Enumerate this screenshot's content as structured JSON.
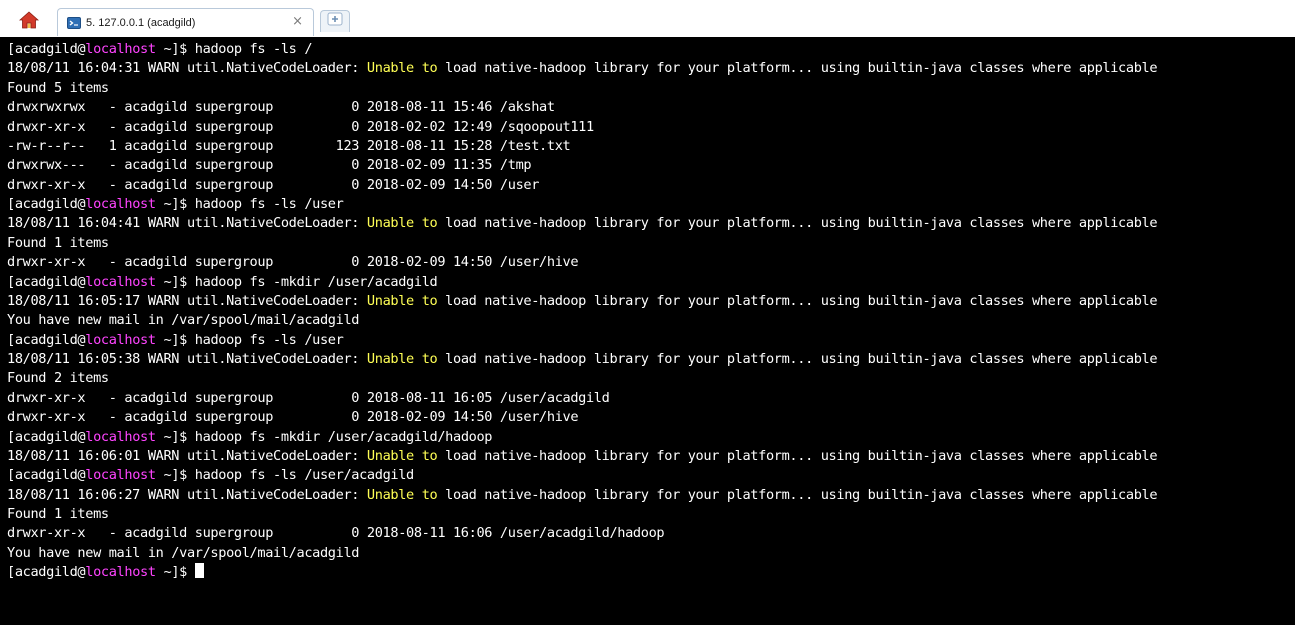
{
  "tab": {
    "title": "5. 127.0.0.1 (acadgild)",
    "close_glyph": "×"
  },
  "colors": {
    "terminal_bg": "#000000",
    "text": "#ffffff",
    "host": "#ff44ff",
    "highlight": "#ffff55",
    "tab_border": "#b9c9da"
  },
  "icons": {
    "home": "home-icon",
    "session": "terminal-session-icon",
    "close": "close-icon",
    "new_tab": "new-tab-icon"
  },
  "terminal": {
    "lines": [
      [
        {
          "t": "[acadgild@"
        },
        {
          "t": "localhost",
          "c": "host"
        },
        {
          "t": " ~]$ hadoop fs -ls /"
        }
      ],
      [
        {
          "t": "18/08/11 16:04:31 WARN util.NativeCodeLoader: "
        },
        {
          "t": "Unable to",
          "c": "warn"
        },
        {
          "t": " load native-hadoop library for your platform... using builtin-java classes where applicable"
        }
      ],
      [
        {
          "t": "Found 5 items"
        }
      ],
      [
        {
          "t": "drwxrwxrwx   - acadgild supergroup          0 2018-08-11 15:46 /akshat"
        }
      ],
      [
        {
          "t": "drwxr-xr-x   - acadgild supergroup          0 2018-02-02 12:49 /sqoopout111"
        }
      ],
      [
        {
          "t": "-rw-r--r--   1 acadgild supergroup        123 2018-08-11 15:28 /test.txt"
        }
      ],
      [
        {
          "t": "drwxrwx---   - acadgild supergroup          0 2018-02-09 11:35 /tmp"
        }
      ],
      [
        {
          "t": "drwxr-xr-x   - acadgild supergroup          0 2018-02-09 14:50 /user"
        }
      ],
      [
        {
          "t": "[acadgild@"
        },
        {
          "t": "localhost",
          "c": "host"
        },
        {
          "t": " ~]$ hadoop fs -ls /user"
        }
      ],
      [
        {
          "t": "18/08/11 16:04:41 WARN util.NativeCodeLoader: "
        },
        {
          "t": "Unable to",
          "c": "warn"
        },
        {
          "t": " load native-hadoop library for your platform... using builtin-java classes where applicable"
        }
      ],
      [
        {
          "t": "Found 1 items"
        }
      ],
      [
        {
          "t": "drwxr-xr-x   - acadgild supergroup          0 2018-02-09 14:50 /user/hive"
        }
      ],
      [
        {
          "t": "[acadgild@"
        },
        {
          "t": "localhost",
          "c": "host"
        },
        {
          "t": " ~]$ hadoop fs -mkdir /user/acadgild"
        }
      ],
      [
        {
          "t": "18/08/11 16:05:17 WARN util.NativeCodeLoader: "
        },
        {
          "t": "Unable to",
          "c": "warn"
        },
        {
          "t": " load native-hadoop library for your platform... using builtin-java classes where applicable"
        }
      ],
      [
        {
          "t": "You have new mail in /var/spool/mail/acadgild"
        }
      ],
      [
        {
          "t": "[acadgild@"
        },
        {
          "t": "localhost",
          "c": "host"
        },
        {
          "t": " ~]$ hadoop fs -ls /user"
        }
      ],
      [
        {
          "t": "18/08/11 16:05:38 WARN util.NativeCodeLoader: "
        },
        {
          "t": "Unable to",
          "c": "warn"
        },
        {
          "t": " load native-hadoop library for your platform... using builtin-java classes where applicable"
        }
      ],
      [
        {
          "t": "Found 2 items"
        }
      ],
      [
        {
          "t": "drwxr-xr-x   - acadgild supergroup          0 2018-08-11 16:05 /user/acadgild"
        }
      ],
      [
        {
          "t": "drwxr-xr-x   - acadgild supergroup          0 2018-02-09 14:50 /user/hive"
        }
      ],
      [
        {
          "t": "[acadgild@"
        },
        {
          "t": "localhost",
          "c": "host"
        },
        {
          "t": " ~]$ hadoop fs -mkdir /user/acadgild/hadoop"
        }
      ],
      [
        {
          "t": "18/08/11 16:06:01 WARN util.NativeCodeLoader: "
        },
        {
          "t": "Unable to",
          "c": "warn"
        },
        {
          "t": " load native-hadoop library for your platform... using builtin-java classes where applicable"
        }
      ],
      [
        {
          "t": "[acadgild@"
        },
        {
          "t": "localhost",
          "c": "host"
        },
        {
          "t": " ~]$ hadoop fs -ls /user/acadgild"
        }
      ],
      [
        {
          "t": "18/08/11 16:06:27 WARN util.NativeCodeLoader: "
        },
        {
          "t": "Unable to",
          "c": "warn"
        },
        {
          "t": " load native-hadoop library for your platform... using builtin-java classes where applicable"
        }
      ],
      [
        {
          "t": "Found 1 items"
        }
      ],
      [
        {
          "t": "drwxr-xr-x   - acadgild supergroup          0 2018-08-11 16:06 /user/acadgild/hadoop"
        }
      ],
      [
        {
          "t": "You have new mail in /var/spool/mail/acadgild"
        }
      ],
      [
        {
          "t": "[acadgild@"
        },
        {
          "t": "localhost",
          "c": "host"
        },
        {
          "t": " ~]$ "
        }
      ]
    ]
  }
}
